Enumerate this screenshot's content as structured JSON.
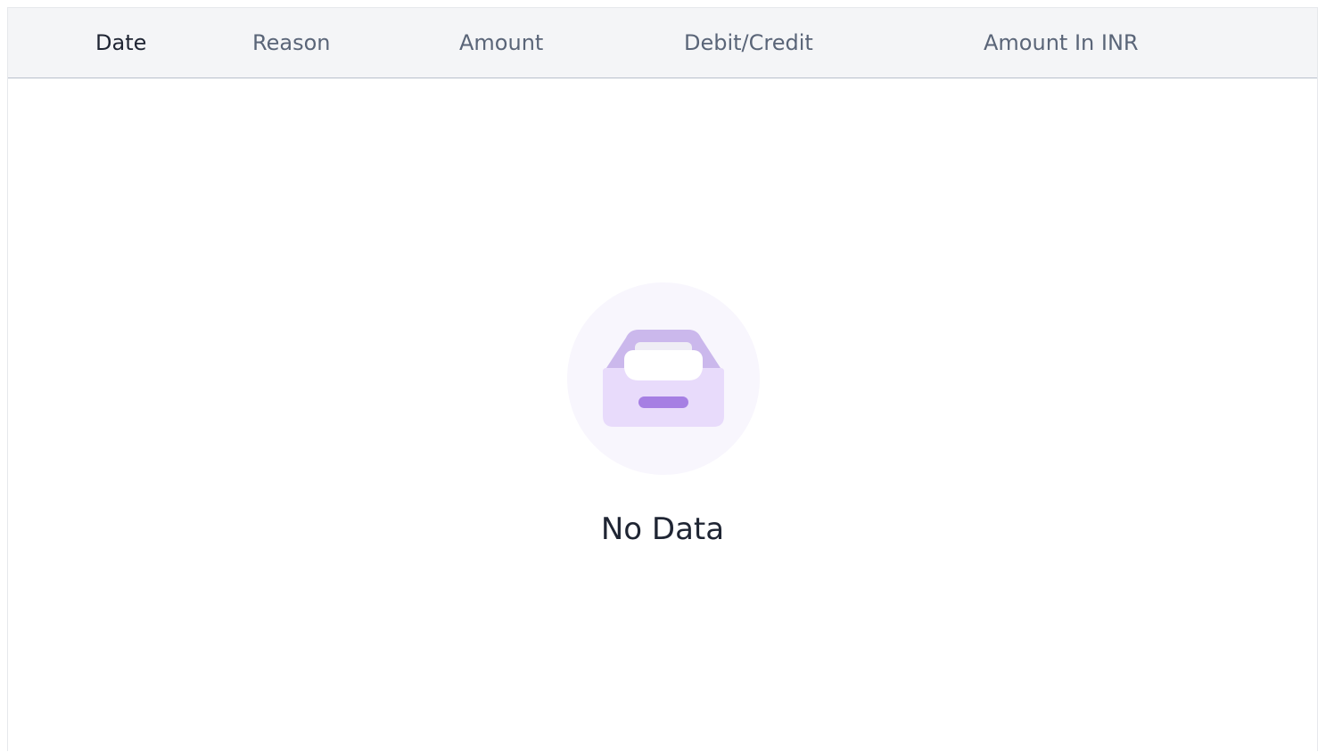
{
  "table": {
    "columns": [
      {
        "label": "Date",
        "active": true
      },
      {
        "label": "Reason",
        "active": false
      },
      {
        "label": "Amount",
        "active": false
      },
      {
        "label": "Debit/Credit",
        "active": false
      },
      {
        "label": "Amount In INR",
        "active": false
      }
    ]
  },
  "empty_state": {
    "icon": "empty-inbox-icon",
    "message": "No Data"
  },
  "colors": {
    "header_bg": "#f4f5f7",
    "header_text": "#5a6578",
    "header_text_active": "#1f2533",
    "icon_circle": "#f8f6fd",
    "icon_tray_back": "#cbb8ec",
    "icon_tray_front": "#e8dbfb",
    "icon_accent": "#a67fe3"
  }
}
